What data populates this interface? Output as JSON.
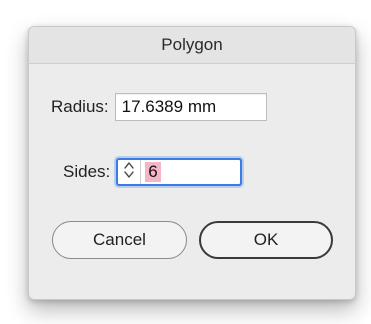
{
  "dialog": {
    "title": "Polygon",
    "radius": {
      "label": "Radius:",
      "value": "17.6389 mm"
    },
    "sides": {
      "label": "Sides:",
      "value": "6"
    },
    "buttons": {
      "cancel": "Cancel",
      "ok": "OK"
    }
  },
  "icons": {
    "stepper": "up-down-chevron-icon"
  },
  "colors": {
    "focus_ring": "#3c7ce0",
    "selection_highlight": "#f4b6c6",
    "dialog_background": "#ececec"
  }
}
